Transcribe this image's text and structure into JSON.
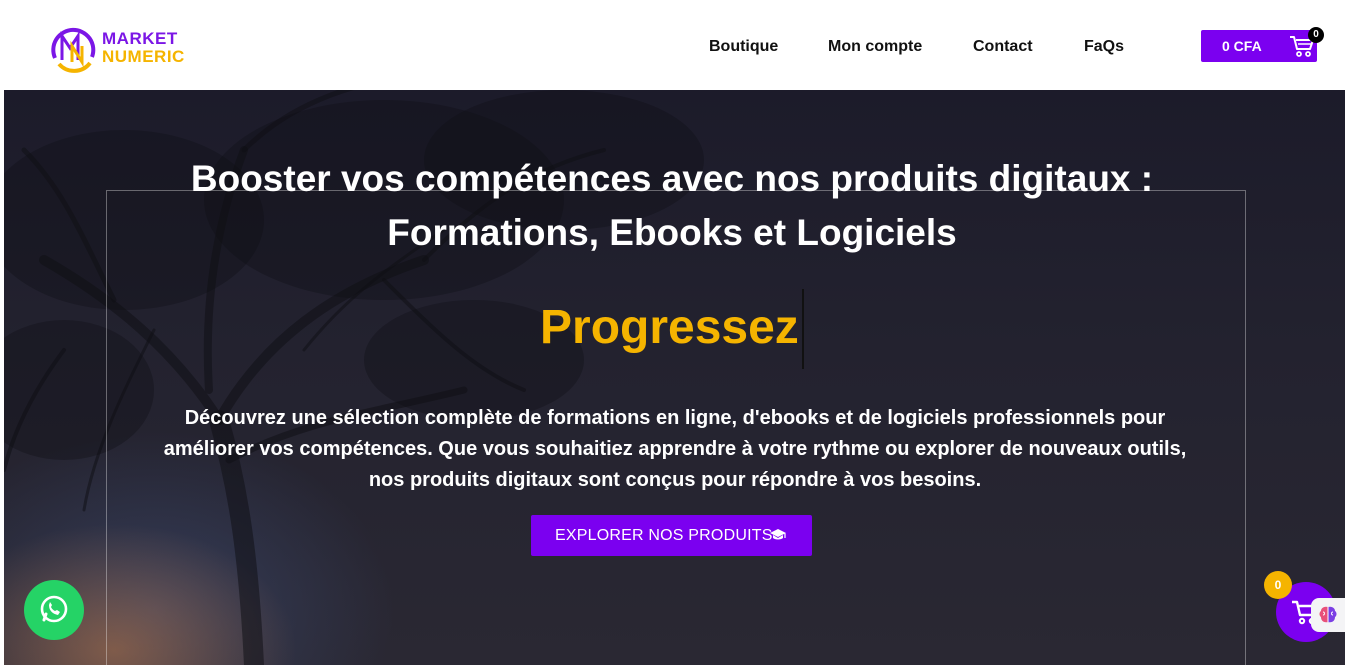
{
  "header": {
    "logo": {
      "line1": "MARKET",
      "line2": "NUMERIC"
    },
    "nav": [
      {
        "label": "Boutique"
      },
      {
        "label": "Mon compte"
      },
      {
        "label": "Contact"
      },
      {
        "label": "FaQs"
      }
    ],
    "cart": {
      "amount": "0 CFA",
      "count": "0",
      "icon": "cart-icon"
    }
  },
  "hero": {
    "headline_line1": "Booster vos compétences avec nos produits digitaux :",
    "headline_line2": "Formations, Ebooks et Logiciels",
    "typed_word": "Progressez",
    "description": "Découvrez une sélection complète de formations en ligne, d'ebooks et de logiciels professionnels pour améliorer vos compétences. Que vous souhaitiez apprendre à votre rythme ou explorer de nouveaux outils, nos produits digitaux sont conçus pour répondre à vos besoins.",
    "cta_label": "EXPLORER NOS PRODUITS",
    "cta_icon": "graduation-cap-icon"
  },
  "floating": {
    "whatsapp_icon": "whatsapp-icon",
    "cart_count": "0",
    "cart_icon": "cart-icon",
    "assistant_icon": "brain-icon"
  },
  "colors": {
    "accent": "#7b00f0",
    "highlight": "#f5b400",
    "whatsapp": "#25d366"
  }
}
